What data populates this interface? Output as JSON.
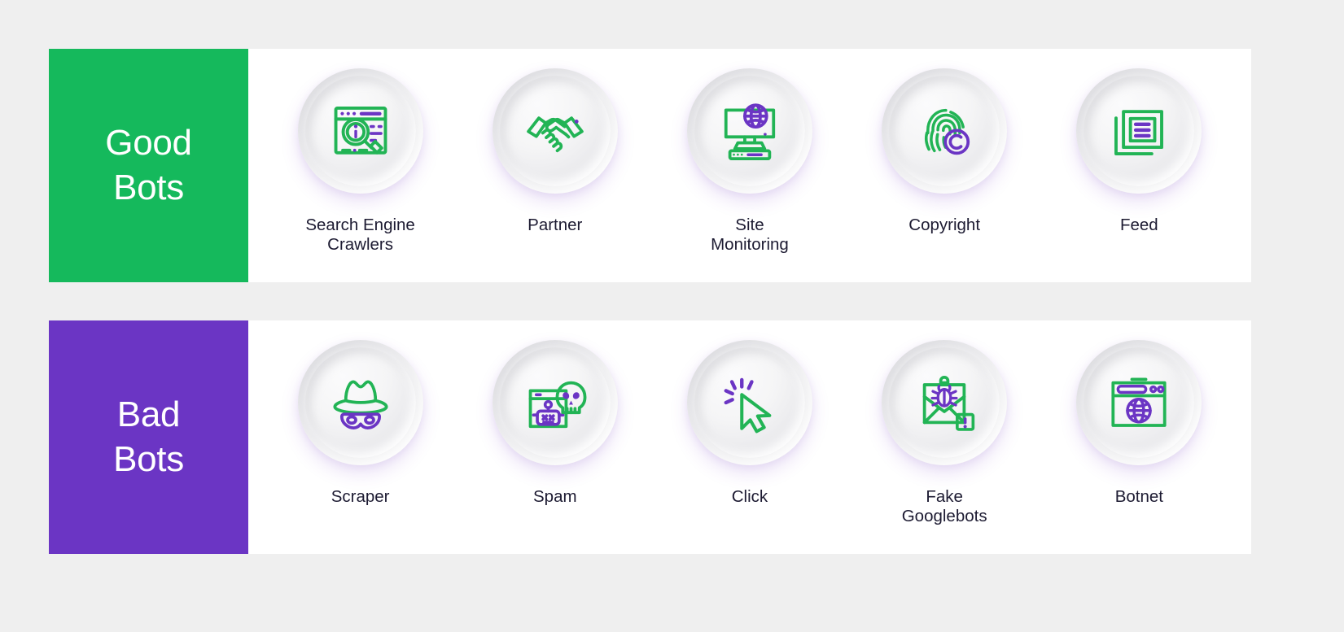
{
  "page": {
    "background_color": "#efefef",
    "card_background": "#ffffff",
    "label_color": "#1d1b32",
    "icon_green": "#22b455",
    "icon_purple": "#6b35c4"
  },
  "rows": [
    {
      "key": "good-bots",
      "panel_color": "#15b95c",
      "title_lines": [
        "Good",
        "Bots"
      ],
      "items": [
        {
          "icon": "search-engine-crawler-icon",
          "label_lines": [
            "Search Engine",
            "Crawlers"
          ]
        },
        {
          "icon": "handshake-icon",
          "label_lines": [
            "Partner"
          ]
        },
        {
          "icon": "site-monitoring-icon",
          "label_lines": [
            "Site",
            "Monitoring"
          ]
        },
        {
          "icon": "fingerprint-copyright-icon",
          "label_lines": [
            "Copyright"
          ]
        },
        {
          "icon": "feed-documents-icon",
          "label_lines": [
            "Feed"
          ]
        }
      ]
    },
    {
      "key": "bad-bots",
      "panel_color": "#6b35c4",
      "title_lines": [
        "Bad",
        "Bots"
      ],
      "items": [
        {
          "icon": "hat-mask-scraper-icon",
          "label_lines": [
            "Scraper"
          ]
        },
        {
          "icon": "spam-robot-skull-icon",
          "label_lines": [
            "Spam"
          ]
        },
        {
          "icon": "click-cursor-icon",
          "label_lines": [
            "Click"
          ]
        },
        {
          "icon": "envelope-bug-icon",
          "label_lines": [
            "Fake",
            "Googlebots"
          ]
        },
        {
          "icon": "botnet-browser-globe-icon",
          "label_lines": [
            "Botnet"
          ]
        }
      ]
    }
  ],
  "good": {
    "panel_color": "#15b95c",
    "title_line1": "Good",
    "title_line2": "Bots",
    "items": [
      {
        "label1": "Search Engine",
        "label2": "Crawlers"
      },
      {
        "label1": "Partner",
        "label2": ""
      },
      {
        "label1": "Site",
        "label2": "Monitoring"
      },
      {
        "label1": "Copyright",
        "label2": ""
      },
      {
        "label1": "Feed",
        "label2": ""
      }
    ]
  },
  "bad": {
    "panel_color": "#6b35c4",
    "title_line1": "Bad",
    "title_line2": "Bots",
    "items": [
      {
        "label1": "Scraper",
        "label2": ""
      },
      {
        "label1": "Spam",
        "label2": ""
      },
      {
        "label1": "Click",
        "label2": ""
      },
      {
        "label1": "Fake",
        "label2": "Googlebots"
      },
      {
        "label1": "Botnet",
        "label2": ""
      }
    ]
  }
}
